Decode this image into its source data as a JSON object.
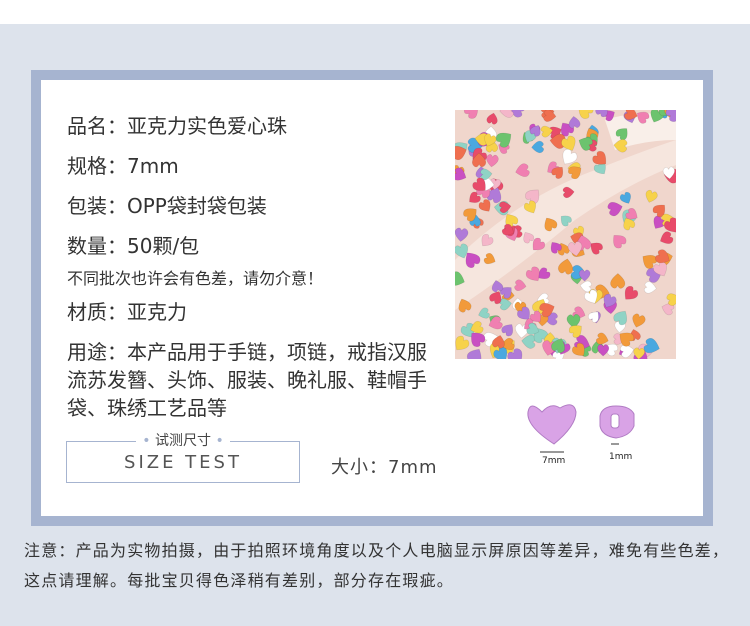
{
  "specs": {
    "name": "品名：亚克力实色爱心珠",
    "size": "规格：7mm",
    "packaging": "包装：OPP袋封袋包装",
    "quantity": "数量：50颗/包",
    "color_note": "不同批次也许会有色差，请勿介意！",
    "material": "材质：亚克力",
    "usage": "用途：本产品用于手链，项链，戒指汉服流苏发簪、头饰、服装、晚礼服、鞋帽手袋、珠绣工艺品等"
  },
  "size_test": {
    "title": "试测尺寸",
    "label": "SIZE TEST",
    "size_text": "大小：7mm"
  },
  "diagram": {
    "width_label": "7mm",
    "hole_label": "1mm",
    "bead_color": "#d9a3e6"
  },
  "notice": "注意：产品为实物拍摄，由于拍照环境角度以及个人电脑显示屏原因等差异，难免有些色差，这点请理解。每批宝贝得色泽稍有差别，部分存在瑕疵。",
  "colors": {
    "frame": "#a6b4d0",
    "background": "#dde3ec"
  }
}
